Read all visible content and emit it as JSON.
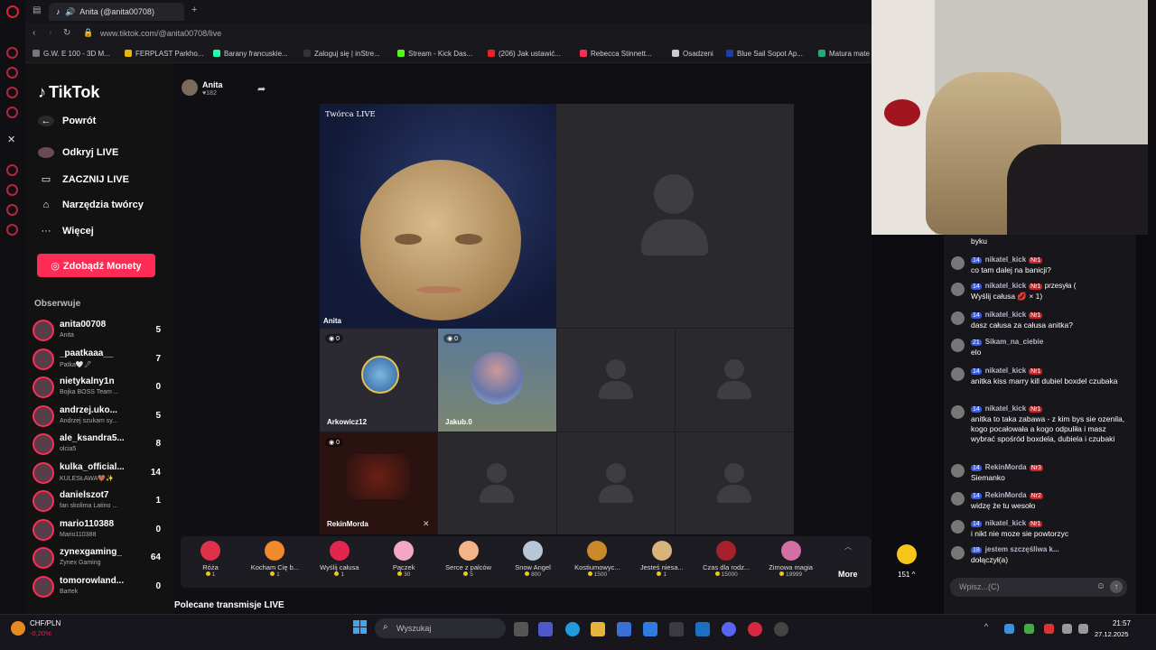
{
  "browser": {
    "tabs": [
      {
        "title": "Anita (@anita00708)"
      }
    ],
    "url": "www.tiktok.com/@anita00708/live",
    "bookmarks": [
      {
        "label": "G.W. E 100 - 3D M...",
        "color": "#777"
      },
      {
        "label": "FERPLAST Parkho...",
        "color": "#e6b800"
      },
      {
        "label": "Barany francuskie...",
        "color": "#2fa"
      },
      {
        "label": "Zaloguj się | inStre...",
        "color": "#333"
      },
      {
        "label": "Stream - Kick Das...",
        "color": "#53fc18"
      },
      {
        "label": "(206) Jak ustawić...",
        "color": "#e22"
      },
      {
        "label": "Rebecca Stinnett...",
        "color": "#fe2c55"
      },
      {
        "label": "Osadzeni",
        "color": "#ccc"
      },
      {
        "label": "Blue Sail Sopot Ap...",
        "color": "#1a3fa8"
      },
      {
        "label": "Matura mate",
        "color": "#2a7"
      }
    ]
  },
  "sidebar": {
    "logo": "TikTok",
    "back": "Powrót",
    "nav": [
      {
        "label": "Odkryj LIVE",
        "icon": "avatar-icon"
      },
      {
        "label": "ZACZNIJ LIVE",
        "icon": "video-camera-icon"
      },
      {
        "label": "Narzędzia twórcy",
        "icon": "home-tools-icon"
      },
      {
        "label": "Więcej",
        "icon": "more-dots-icon"
      }
    ],
    "coins_button": "Zdobądź Monety",
    "following_header": "Obserwuje",
    "following": [
      {
        "name": "anita00708",
        "sub": "Anita",
        "count": "5"
      },
      {
        "name": "_paatkaaa__",
        "sub": "Patka🤍🖋",
        "count": "7"
      },
      {
        "name": "nietykalny1n",
        "sub": "Bojka BOSS Team ...",
        "count": "0"
      },
      {
        "name": "andrzej.uko...",
        "sub": "Andrzej szukam sy...",
        "count": "5"
      },
      {
        "name": "ale_ksandra5...",
        "sub": "olcia5",
        "count": "8"
      },
      {
        "name": "kulka_official...",
        "sub": "KULESŁAWA🤎✨",
        "count": "14"
      },
      {
        "name": "danielszot7",
        "sub": "fan skolima Latino ...",
        "count": "1"
      },
      {
        "name": "mario110388",
        "sub": "Mario110388",
        "count": "0"
      },
      {
        "name": "zynexgaming_",
        "sub": "Zynex Gaming",
        "count": "64"
      },
      {
        "name": "tomorowland...",
        "sub": "Bartek",
        "count": "0"
      }
    ]
  },
  "live": {
    "host_name": "Anita",
    "host_likes": "182",
    "creator_tag": "Twórca LIVE",
    "host_cell_name": "Anita",
    "guests": [
      {
        "name": "Arkowicz12",
        "score": "0"
      },
      {
        "name": "Jakub.0",
        "score": "0"
      },
      {
        "name": "RekinMorda",
        "score": "0"
      }
    ],
    "recommended": "Polecane transmisje LIVE"
  },
  "gifts": {
    "items": [
      {
        "name": "Róża",
        "price": "1",
        "color": "#e0314b"
      },
      {
        "name": "Kocham Cię b...",
        "price": "1",
        "color": "#f08a2a"
      },
      {
        "name": "Wyślij całusa",
        "price": "1",
        "color": "#e3264b"
      },
      {
        "name": "Pączek",
        "price": "30",
        "color": "#f4a7c4"
      },
      {
        "name": "Serce z palców",
        "price": "5",
        "color": "#f3b48a"
      },
      {
        "name": "Snow Angel",
        "price": "800",
        "color": "#b8c7d8"
      },
      {
        "name": "Kostiumowyc...",
        "price": "1500",
        "color": "#c88a2b"
      },
      {
        "name": "Jesteś niesa...",
        "price": "1",
        "color": "#d8b37a"
      },
      {
        "name": "Czas dla rodz...",
        "price": "15000",
        "color": "#a6212b"
      },
      {
        "name": "Zimowa magia",
        "price": "19999",
        "color": "#d36fa3"
      }
    ],
    "more_label": "More",
    "balance": "151"
  },
  "chat": {
    "messages": [
      {
        "level": "",
        "user": "",
        "rank": "",
        "text": "byku"
      },
      {
        "level": "14",
        "user": "nikatel_kick",
        "rank": "Nr1",
        "text": "co tam dalej na banicji?"
      },
      {
        "level": "14",
        "user": "nikatel_kick",
        "rank": "Nr1",
        "text": "Wyślij całusa 💋 × 1)",
        "inline": "przesyła ("
      },
      {
        "level": "14",
        "user": "nikatel_kick",
        "rank": "Nr1",
        "text": "dasz całusa za całusa anitka?"
      },
      {
        "level": "21",
        "user": "Sikam_na_ciebie",
        "rank": "",
        "text": "elo"
      },
      {
        "level": "14",
        "user": "nikatel_kick",
        "rank": "Nr1",
        "text": "anitka kiss marry kill dubiel boxdel czubaka"
      },
      {
        "level": "14",
        "user": "nikatel_kick",
        "rank": "Nr1",
        "text": "anitka to taka zabawa - z kim bys sie ozenila, kogo pocałowała a kogo odpuliła i masz wybrać spośród boxdela, dubiela i czubaki"
      },
      {
        "level": "14",
        "user": "RekinMorda",
        "rank": "Nr3",
        "text": "Siemanko"
      },
      {
        "level": "14",
        "user": "RekinMorda",
        "rank": "Nr2",
        "text": "widzę że tu wesoło"
      },
      {
        "level": "14",
        "user": "nikatel_kick",
        "rank": "Nr1",
        "text": "i nikt nie moze sie powtorzyc"
      },
      {
        "level": "18",
        "user": "jestem szczęśliwa k...",
        "rank": "",
        "text": "dołączył(a)"
      }
    ],
    "input_placeholder": "Wpisz...(C)"
  },
  "taskbar": {
    "ticker_name": "CHF/PLN",
    "ticker_change": "-0,20%",
    "search_placeholder": "Wyszukaj",
    "time": "21:57",
    "date": "27.12.2025"
  }
}
